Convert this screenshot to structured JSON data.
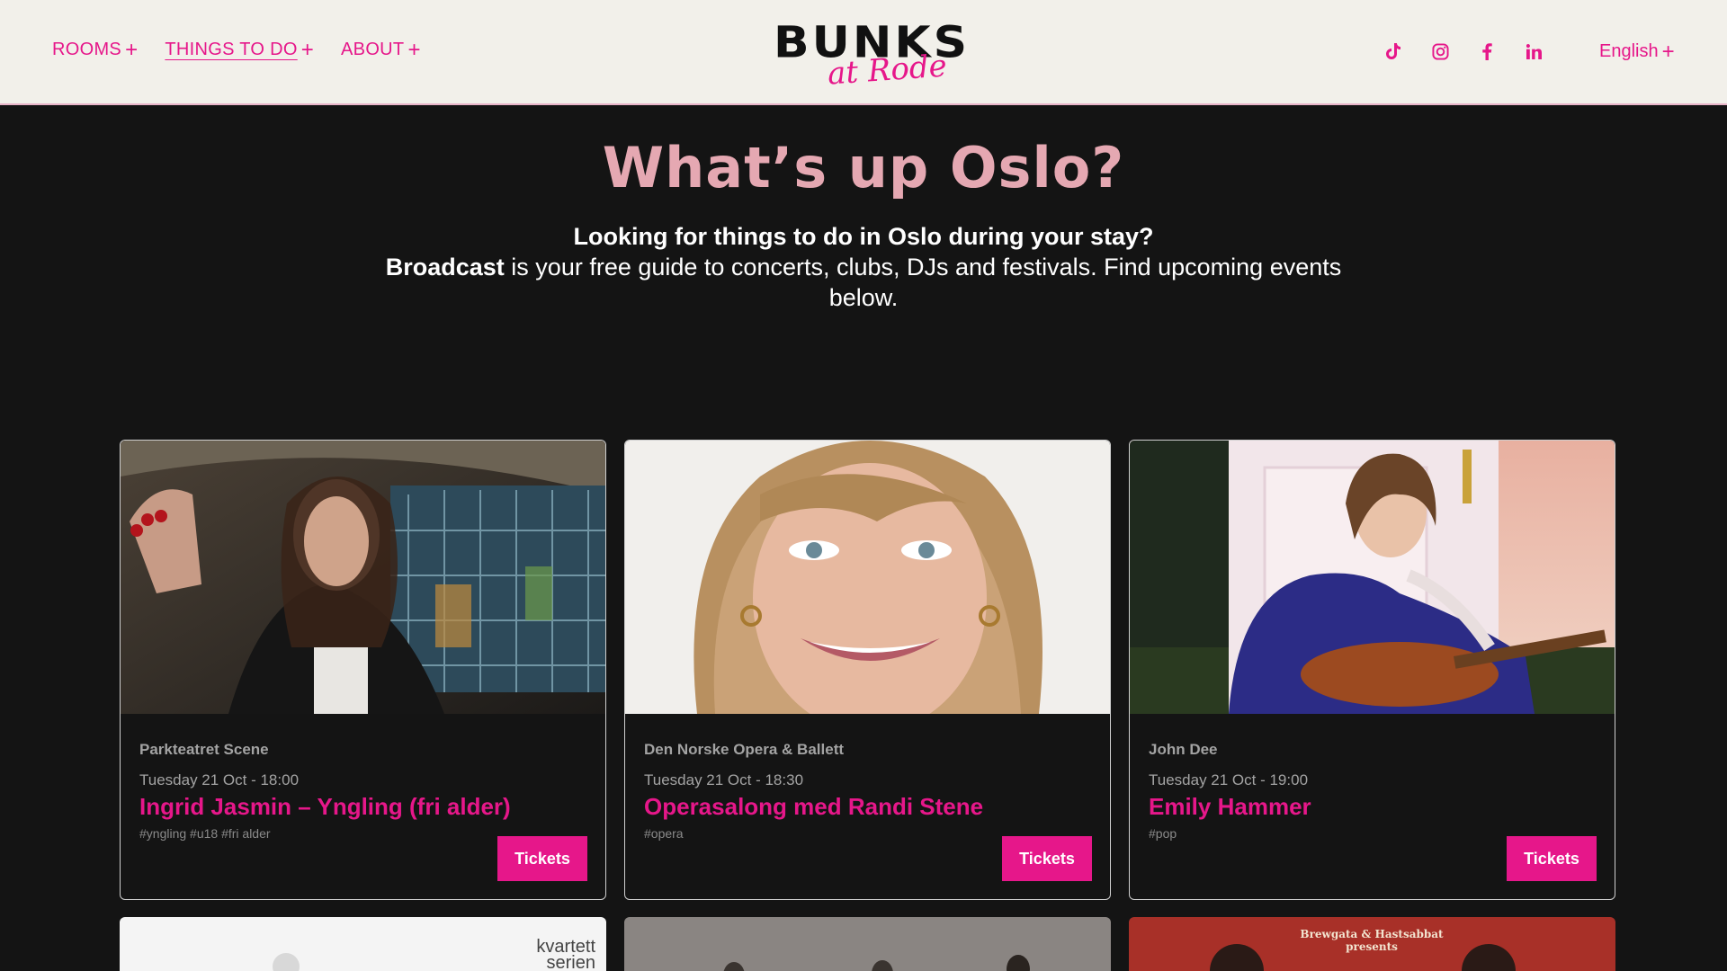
{
  "header": {
    "nav": [
      {
        "label": "ROOMS",
        "active": false
      },
      {
        "label": "THINGS TO DO",
        "active": true
      },
      {
        "label": "ABOUT",
        "active": false
      }
    ],
    "logo": {
      "main": "BUNKS",
      "sub": "at Rode"
    },
    "socials": [
      "tiktok-icon",
      "instagram-icon",
      "facebook-icon",
      "linkedin-icon"
    ],
    "language": "English"
  },
  "hero": {
    "title": "What’s up Oslo?",
    "line1": "Looking for things to do in Oslo during your stay?",
    "brand": "Broadcast",
    "line2": " is your free guide to concerts, clubs, DJs and festivals. Find upcoming events below."
  },
  "events": [
    {
      "venue": "Parkteatret Scene",
      "date": "Tuesday 21 Oct - 18:00",
      "title": "Ingrid Jasmin – Yngling (fri alder)",
      "tags": "#yngling #u18 #fri alder",
      "button": "Tickets"
    },
    {
      "venue": "Den Norske Opera & Ballett",
      "date": "Tuesday 21 Oct - 18:30",
      "title": "Operasalong med Randi Stene",
      "tags": "#opera",
      "button": "Tickets"
    },
    {
      "venue": "John Dee",
      "date": "Tuesday 21 Oct - 19:00",
      "title": "Emily Hammer",
      "tags": "#pop",
      "button": "Tickets"
    }
  ],
  "next_row": {
    "card1_text": "kvartett serien",
    "card3_text": "Brewgata & Hastsabbat presents"
  },
  "colors": {
    "accent": "#e6178a",
    "hero_title": "#e5a8b2",
    "header_bg": "#f2f0ea",
    "page_bg": "#141414"
  }
}
